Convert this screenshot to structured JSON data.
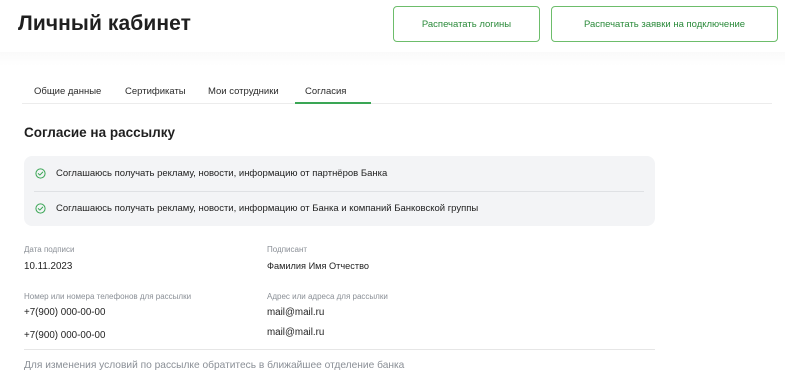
{
  "header": {
    "title": "Личный кабинет",
    "print_logins_label": "Распечатать логины",
    "print_requests_label": "Распечатать заявки на подключение"
  },
  "tabs": [
    {
      "label": "Общие данные",
      "active": false
    },
    {
      "label": "Сертификаты",
      "active": false
    },
    {
      "label": "Мои сотрудники",
      "active": false
    },
    {
      "label": "Согласия",
      "active": true
    }
  ],
  "accent_color": "#3aa655",
  "section": {
    "title": "Согласие на рассылку"
  },
  "consents": [
    {
      "icon": "check-circle-icon",
      "text": "Соглашаюсь получать рекламу, новости, информацию от партнёров Банка"
    },
    {
      "icon": "check-circle-icon",
      "text": "Соглашаюсь получать рекламу, новости, информацию от Банка и компаний Банковской группы"
    }
  ],
  "details": {
    "sign_date_label": "Дата подписи",
    "sign_date_value": "10.11.2023",
    "signer_label": "Подписант",
    "signer_value": "Фамилия Имя Отчество",
    "phones_label": "Номер или номера телефонов для рассылки",
    "phones": [
      "+7(900) 000-00-00",
      "+7(900) 000-00-00"
    ],
    "emails_label": "Адрес или адреса для рассылки",
    "emails": [
      "mail@mail.ru",
      "mail@mail.ru"
    ]
  },
  "footer": {
    "note": "Для изменения условий по рассылке обратитесь в ближайшее отделение банка"
  }
}
